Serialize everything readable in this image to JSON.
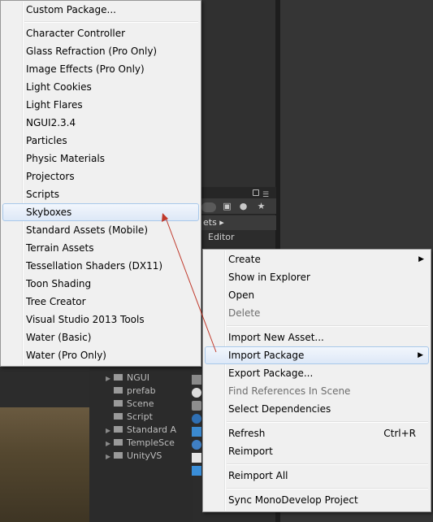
{
  "assets_panel": {
    "breadcrumb": "ets ▸",
    "editor_label": "Editor"
  },
  "hierarchy": {
    "items": [
      {
        "label": "NGUI",
        "expandable": true
      },
      {
        "label": "prefab",
        "expandable": false
      },
      {
        "label": "Scene",
        "expandable": false
      },
      {
        "label": "Script",
        "expandable": false
      },
      {
        "label": "Standard A",
        "expandable": true
      },
      {
        "label": "TempleSce",
        "expandable": true
      },
      {
        "label": "UnityVS",
        "expandable": true
      }
    ]
  },
  "package_menu": {
    "items": [
      {
        "label": "Custom Package...",
        "state": "normal"
      },
      {
        "label": "Character Controller",
        "state": "normal"
      },
      {
        "label": "Glass Refraction (Pro Only)",
        "state": "normal"
      },
      {
        "label": "Image Effects (Pro Only)",
        "state": "normal"
      },
      {
        "label": "Light Cookies",
        "state": "normal"
      },
      {
        "label": "Light Flares",
        "state": "normal"
      },
      {
        "label": "NGUI2.3.4",
        "state": "normal"
      },
      {
        "label": "Particles",
        "state": "normal"
      },
      {
        "label": "Physic Materials",
        "state": "normal"
      },
      {
        "label": "Projectors",
        "state": "normal"
      },
      {
        "label": "Scripts",
        "state": "normal"
      },
      {
        "label": "Skyboxes",
        "state": "highlighted"
      },
      {
        "label": "Standard Assets (Mobile)",
        "state": "normal"
      },
      {
        "label": "Terrain Assets",
        "state": "normal"
      },
      {
        "label": "Tessellation Shaders (DX11)",
        "state": "normal"
      },
      {
        "label": "Toon Shading",
        "state": "normal"
      },
      {
        "label": "Tree Creator",
        "state": "normal"
      },
      {
        "label": "Visual Studio 2013 Tools",
        "state": "normal"
      },
      {
        "label": "Water (Basic)",
        "state": "normal"
      },
      {
        "label": "Water (Pro Only)",
        "state": "normal"
      }
    ]
  },
  "context_menu": {
    "create": "Create",
    "show_in_explorer": "Show in Explorer",
    "open": "Open",
    "delete": "Delete",
    "import_new_asset": "Import New Asset...",
    "import_package": "Import Package",
    "export_package": "Export Package...",
    "find_references": "Find References In Scene",
    "select_dependencies": "Select Dependencies",
    "refresh": "Refresh",
    "refresh_shortcut": "Ctrl+R",
    "reimport": "Reimport",
    "reimport_all": "Reimport All",
    "sync_monodevelop": "Sync MonoDevelop Project"
  },
  "colors": {
    "menu_bg": "#f0f0f0",
    "highlight_border": "#a8c8ea",
    "annotation_arrow": "#c0392b",
    "editor_dark": "#2c2c2c"
  }
}
